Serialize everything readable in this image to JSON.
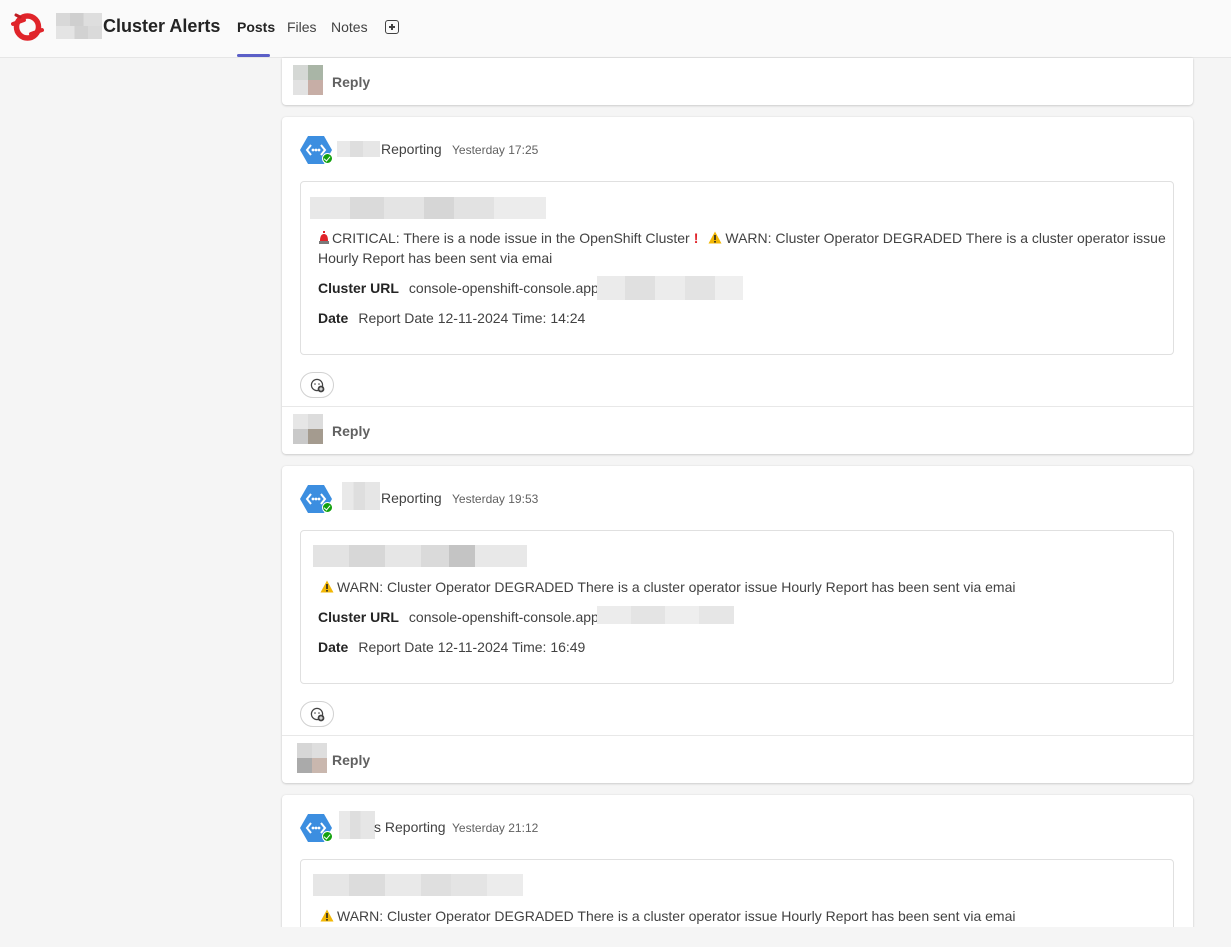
{
  "header": {
    "team_name": "Cluster Alerts",
    "tabs": [
      {
        "label": "Posts",
        "active": true
      },
      {
        "label": "Files",
        "active": false
      },
      {
        "label": "Notes",
        "active": false
      }
    ],
    "add_tab_icon": "plus-square-icon"
  },
  "reply_label": "Reply",
  "posts": [
    {
      "sender": "Reporting",
      "time": "Yesterday 17:25",
      "alert_critical": "CRITICAL: There is a node issue in the OpenShift Cluster",
      "alert_warn_inline": "WARN: Cluster Operator DEGRADED There is a cluster operator issue",
      "alert_tail": "Hourly Report has been sent via emai",
      "cluster_url_label": "Cluster URL",
      "cluster_url_value": "console-openshift-console.apps",
      "date_label": "Date",
      "date_value": "Report Date 12-11-2024 Time: 14:24"
    },
    {
      "sender": "Reporting",
      "time": "Yesterday 19:53",
      "alert_warn": "WARN: Cluster Operator DEGRADED There is a cluster operator issue Hourly Report has been sent via emai",
      "cluster_url_label": "Cluster URL",
      "cluster_url_value": "console-openshift-console.apps",
      "date_label": "Date",
      "date_value": "Report Date 12-11-2024 Time: 16:49"
    },
    {
      "sender": "Reporting",
      "sender_prefix": "s",
      "time": "Yesterday 21:12",
      "alert_warn": "WARN: Cluster Operator DEGRADED There is a cluster operator issue Hourly Report has been sent via emai"
    }
  ],
  "colors": {
    "accent": "#5b5fc7",
    "presence_available": "#13a10e",
    "bot_blue": "#3c8ee0",
    "critical_red": "#e0242a",
    "warn_amber": "#f2b705"
  }
}
